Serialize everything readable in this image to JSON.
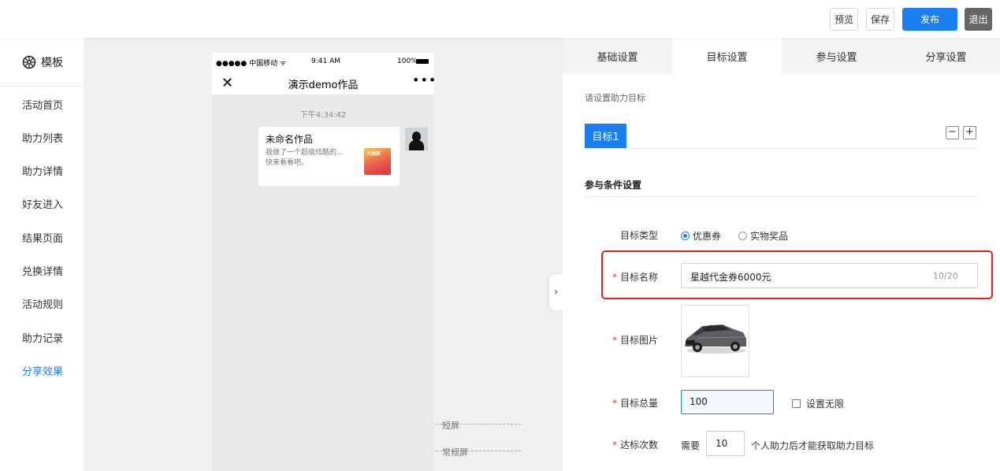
{
  "toolbar": {
    "preview": "预览",
    "save": "保存",
    "publish": "发布",
    "exit": "退出"
  },
  "sidebar": {
    "header": "模板",
    "header_icon": "wheel-icon",
    "items": [
      {
        "label": "活动首页",
        "active": false
      },
      {
        "label": "助力列表",
        "active": false
      },
      {
        "label": "助力详情",
        "active": false
      },
      {
        "label": "好友进入",
        "active": false
      },
      {
        "label": "结果页面",
        "active": false
      },
      {
        "label": "兑换详情",
        "active": false
      },
      {
        "label": "活动规则",
        "active": false
      },
      {
        "label": "助力记录",
        "active": false
      },
      {
        "label": "分享效果",
        "active": true
      }
    ]
  },
  "phone": {
    "carrier": "●●●●● 中国移动 ᯤ",
    "time": "9:41 AM",
    "battery": "100%",
    "nav_title": "演示demo作品",
    "close_symbol": "✕",
    "more_symbol": "•••",
    "chat_time": "下午4:34:42",
    "card": {
      "title": "未命名作品",
      "desc_line1": "我做了一个超级炫酷的...",
      "desc_line2": "快来看看吧。",
      "thumb_text": "大抽奖"
    },
    "short_screen": "短屏",
    "normal_screen": "常规屏"
  },
  "tabs": [
    {
      "label": "基础设置",
      "active": false
    },
    {
      "label": "目标设置",
      "active": true
    },
    {
      "label": "参与设置",
      "active": false
    },
    {
      "label": "分享设置",
      "active": false
    }
  ],
  "form": {
    "hint": "请设置助力目标",
    "target_tab": "目标1",
    "minus": "−",
    "plus": "+",
    "section_title": "参与条件设置",
    "type_label": "目标类型",
    "type_options": [
      {
        "label": "优惠券",
        "selected": true
      },
      {
        "label": "实物奖品",
        "selected": false
      }
    ],
    "name_label": "目标名称",
    "name_value": "星越代金券6000元",
    "name_count": "10/20",
    "image_label": "目标图片",
    "qty_label": "目标总量",
    "qty_value": "100",
    "unlimited_label": "设置无限",
    "reach_label": "达标次数",
    "reach_prefix": "需要",
    "reach_value": "10",
    "reach_suffix": "个人助力后才能获取助力目标",
    "required_mark": "*"
  },
  "colors": {
    "accent": "#1a7ff0",
    "highlight_border": "#e0211b",
    "required": "#e53935"
  }
}
